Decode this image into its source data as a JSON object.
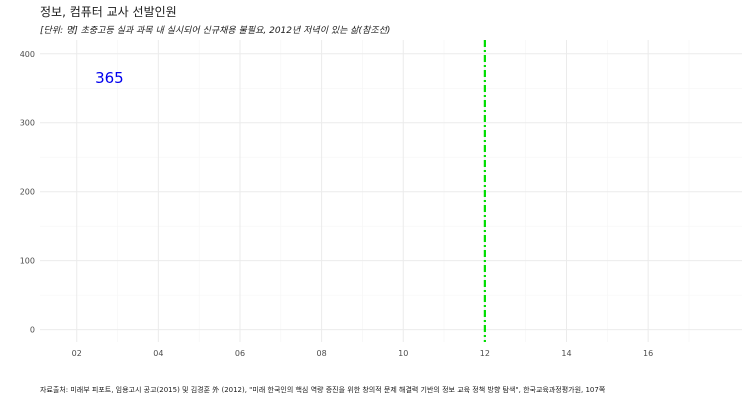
{
  "chart_data": {
    "type": "line",
    "title": "정보, 컴퓨터 교사 선발인원",
    "subtitle": "[단위: 명] 초중고등 실과 과목 내 실시되어 신규채용 불필요, 2012년 저녁이 있는 삶(참조선)",
    "caption": "자료출처: 미래부 피포트, 임용고시 공고(2015) 및 김경훈 外 (2012), \"미래 한국인의 핵심 역량 증진을 위한 창의적 문제 해결력 기반의 정보 교육 정책 방향 탐색\", 한국교육과정평가원, 107쪽",
    "xlabel": "",
    "ylabel": "",
    "xlim": [
      1.1,
      18.3
    ],
    "ylim": [
      -18,
      420
    ],
    "x_ticks": [
      2,
      4,
      6,
      8,
      10,
      12,
      14,
      16
    ],
    "x_tick_labels": [
      "02",
      "04",
      "06",
      "08",
      "10",
      "12",
      "14",
      "16"
    ],
    "y_ticks": [
      0,
      100,
      200,
      300,
      400
    ],
    "y_tick_labels": [
      "0",
      "100",
      "200",
      "300",
      "400"
    ],
    "points": [
      {
        "x": 2.8,
        "y": 365,
        "label": "365"
      }
    ],
    "reference_line": {
      "x": 12
    },
    "grid": true,
    "colors": {
      "value_label": "#0000ee",
      "reference_line": "#00dd00",
      "grid_major": "#ebebeb",
      "grid_minor": "#f5f5f5"
    }
  }
}
